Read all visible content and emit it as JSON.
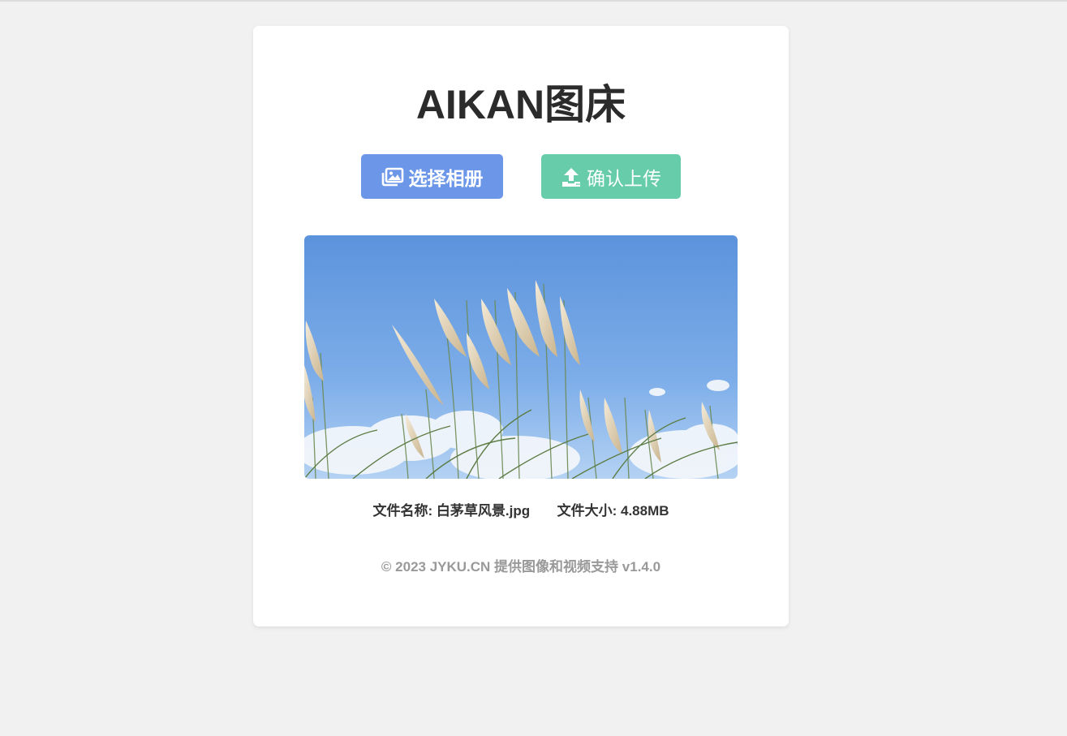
{
  "header": {
    "title": "AIKAN图床"
  },
  "actions": {
    "select_label": "选择相册",
    "select_icon": "images-icon",
    "upload_label": "确认上传",
    "upload_icon": "upload-icon"
  },
  "file": {
    "name_label": "文件名称:",
    "name_value": "白茅草风景.jpg",
    "size_label": "文件大小:",
    "size_value": "4.88MB"
  },
  "footer": {
    "text": "© 2023 JYKU.CN 提供图像和视频支持 v1.4.0"
  },
  "colors": {
    "background": "#f1f1f1",
    "card": "#ffffff",
    "select_button": "#6c97e9",
    "upload_button": "#66ccaa",
    "title_text": "#2b2b2b",
    "footer_text": "#999999"
  }
}
